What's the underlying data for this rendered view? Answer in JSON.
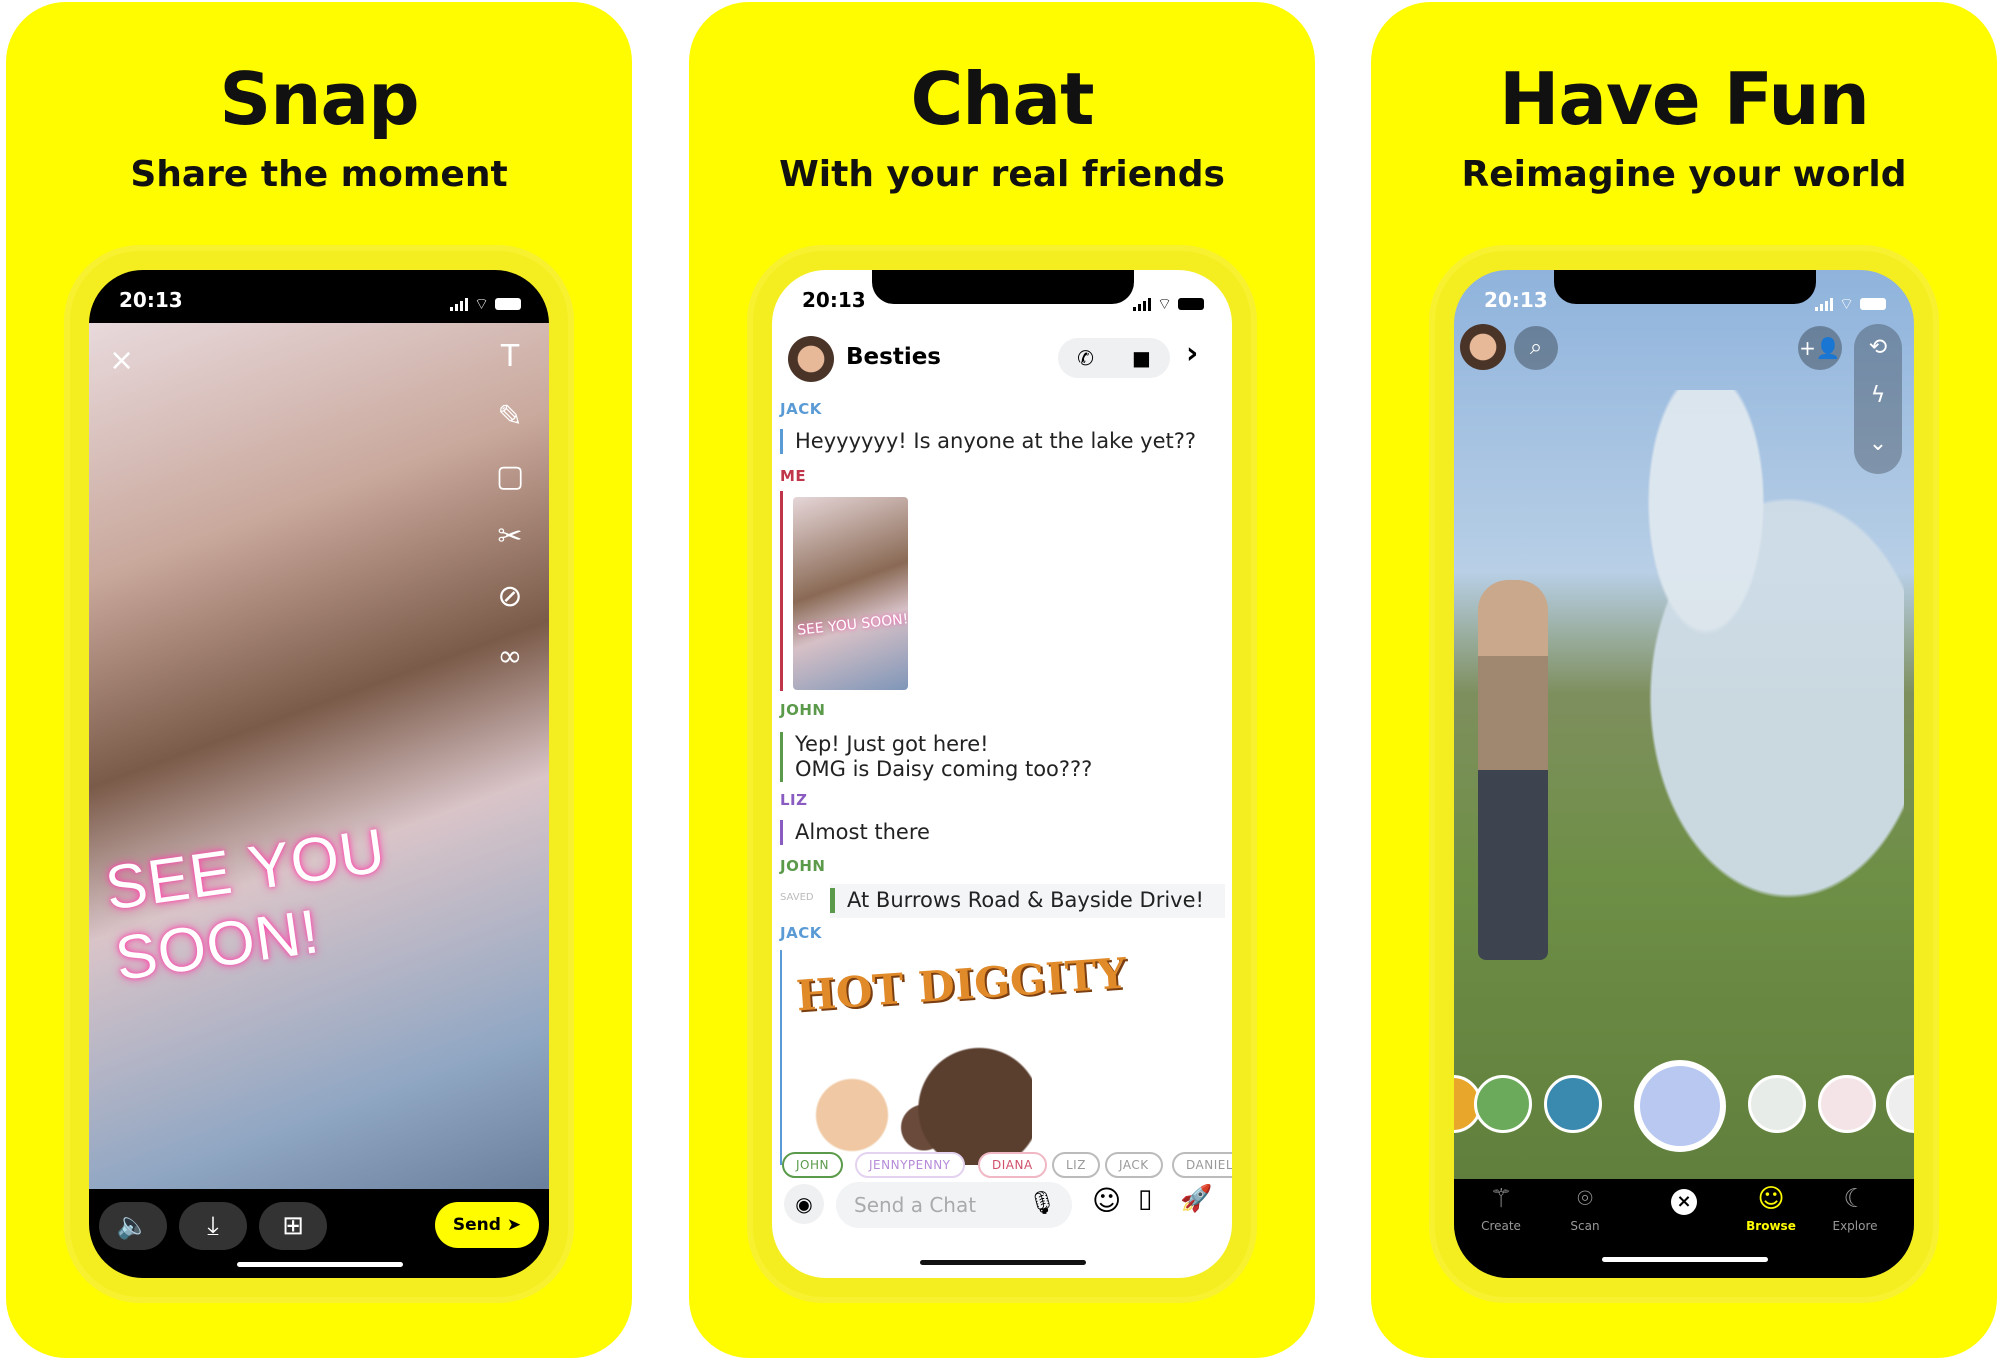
{
  "panels": [
    {
      "title": "Snap",
      "subtitle": "Share the moment"
    },
    {
      "title": "Chat",
      "subtitle": "With your real friends"
    },
    {
      "title": "Have Fun",
      "subtitle": "Reimagine your world"
    }
  ],
  "status_time": "20:13",
  "snap": {
    "caption": "SEE YOU SOON!",
    "send_label": "Send",
    "tools": [
      "text-icon",
      "pencil-icon",
      "sticker-icon",
      "scissors-icon",
      "paperclip-icon",
      "loop-icon"
    ]
  },
  "chat": {
    "header": "Besties",
    "messages": [
      {
        "sender": "JACK",
        "text": "Heyyyyyy! Is anyone at the lake yet??",
        "color": "#5b9bd5"
      },
      {
        "sender": "ME",
        "text": "",
        "color": "#c0354a",
        "image_caption": "SEE YOU SOON!"
      },
      {
        "sender": "JOHN",
        "text": "Yep! Just got here!",
        "text2": "OMG is Daisy coming too???",
        "color": "#5a9a4a"
      },
      {
        "sender": "LIZ",
        "text": "Almost there",
        "color": "#8a5bc0"
      },
      {
        "sender": "JOHN",
        "text": "At Burrows Road & Bayside Drive!",
        "saved": "SAVED",
        "color": "#5a9a4a"
      },
      {
        "sender": "JACK",
        "sticker": "HOT DIGGITY",
        "color": "#5b9bd5"
      }
    ],
    "chips": [
      {
        "name": "JOHN",
        "color": "#5a9a4a"
      },
      {
        "name": "JENNYPENNY",
        "color": "#b58ad8"
      },
      {
        "name": "DIANA",
        "color": "#d0506a"
      },
      {
        "name": "LIZ",
        "color": "#999"
      },
      {
        "name": "JACK",
        "color": "#999"
      },
      {
        "name": "DANIEL",
        "color": "#999"
      }
    ],
    "input_placeholder": "Send a Chat"
  },
  "fun": {
    "nav": [
      "Create",
      "Scan",
      "",
      "Browse",
      "Explore"
    ],
    "active": "Browse",
    "accent": "#fffc00"
  },
  "colors": {
    "brand": "#fffc00"
  }
}
